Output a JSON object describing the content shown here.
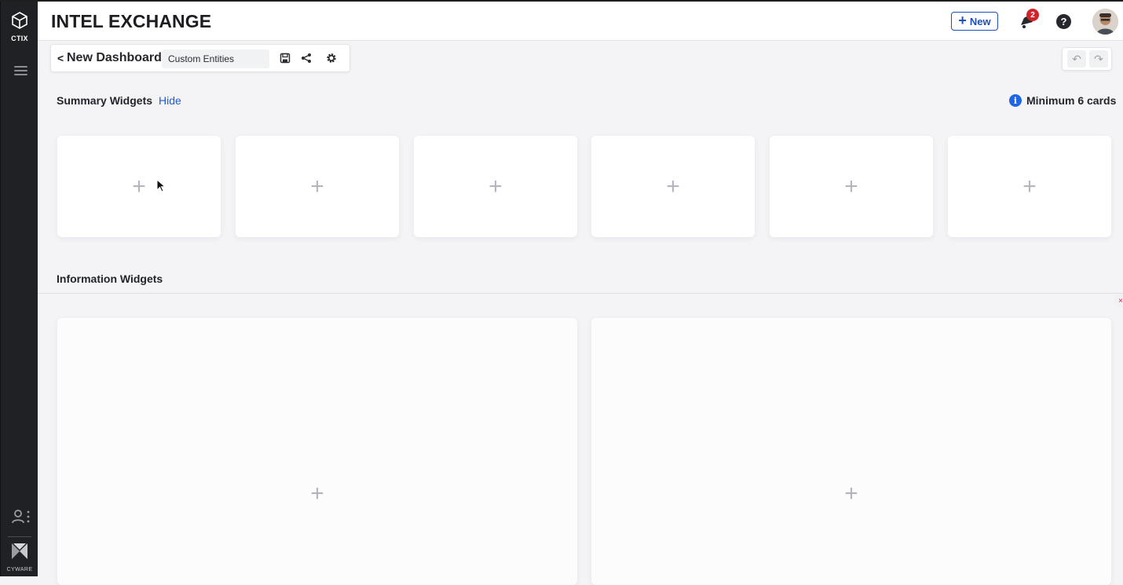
{
  "sidebar": {
    "logo_label": "CTIX",
    "footer_label": "CYWARE"
  },
  "header": {
    "title": "INTEL EXCHANGE",
    "new_button_label": "New",
    "notification_count": "2",
    "help_label": "?"
  },
  "dashboard": {
    "back_label": "<",
    "name": "New Dashboard",
    "selected_entity": "Custom Entities"
  },
  "summary": {
    "title": "Summary Widgets",
    "hide_label": "Hide",
    "min_note": "Minimum 6 cards",
    "info_label": "i",
    "cards": [
      "+",
      "+",
      "+",
      "+",
      "+",
      "+"
    ]
  },
  "information": {
    "title": "Information Widgets",
    "cards": [
      "+",
      "+"
    ]
  },
  "controls": {
    "undo_label": "↶",
    "redo_label": "↷",
    "panel_close_label": "×"
  },
  "colors": {
    "accent": "#1f4fb8",
    "badge": "#d3232a",
    "sidebar": "#202124",
    "info": "#1e66e6"
  }
}
